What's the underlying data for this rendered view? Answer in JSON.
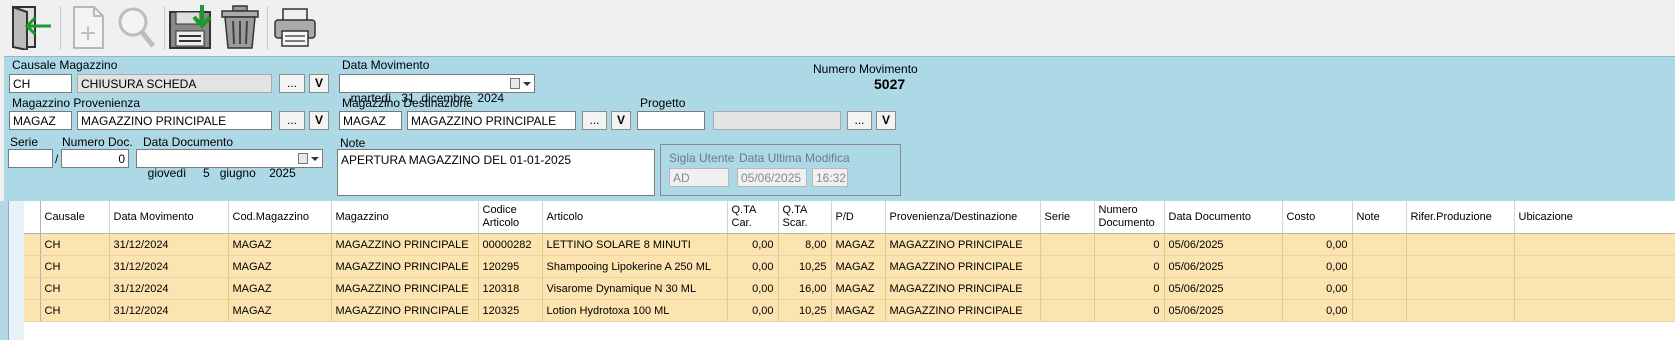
{
  "toolbar": {
    "buttons": [
      {
        "name": "exit-icon"
      },
      {
        "name": "new-document-icon"
      },
      {
        "name": "search-icon"
      },
      {
        "name": "save-icon"
      },
      {
        "name": "trash-icon"
      },
      {
        "name": "printer-icon"
      }
    ]
  },
  "form": {
    "causale_label": "Causale Magazzino",
    "causale_code": "CH",
    "causale_desc": "CHIUSURA SCHEDA",
    "dots": "...",
    "v": "V",
    "data_mov_label": "Data Movimento",
    "data_mov_value": "martedì   31  dicembre  2024",
    "num_mov_label": "Numero Movimento",
    "num_mov_value": "5027",
    "prov_label": "Magazzino Provenienza",
    "prov_code": "MAGAZ",
    "prov_desc": "MAGAZZINO PRINCIPALE",
    "dest_label": "Magazzino Destinazione",
    "dest_code": "MAGAZ",
    "dest_desc": "MAGAZZINO PRINCIPALE",
    "progetto_label": "Progetto",
    "progetto_code": "",
    "progetto_desc": "",
    "serie_label": "Serie",
    "serie_value": "",
    "slash": "/",
    "numdoc_label": "Numero Doc.",
    "numdoc_value": "0",
    "datadoc_label": "Data Documento",
    "datadoc_value": "giovedì     5   giugno    2025",
    "note_label": "Note",
    "note_value": "APERTURA MAGAZZINO DEL 01-01-2025",
    "sigla_label": "Sigla Utente",
    "sigla_value": "AD",
    "ultima_label": "Data Ultima Modifica",
    "ultima_date": "05/06/2025",
    "ultima_time": "16:32"
  },
  "grid": {
    "columns": [
      "Causale",
      "Data Movimento",
      "Cod.Magazzino",
      "Magazzino",
      "Codice Articolo",
      "Articolo",
      "Q.TA Car.",
      "Q.TA Scar.",
      "P/D",
      "Provenienza/Destinazione",
      "Serie",
      "Numero Documento",
      "Data Documento",
      "Costo",
      "Note",
      "Rifer.Produzione",
      "Ubicazione"
    ],
    "rows": [
      [
        "CH",
        "31/12/2024",
        "MAGAZ",
        "MAGAZZINO PRINCIPALE",
        "00000282",
        "LETTINO SOLARE 8 MINUTI",
        "0,00",
        "8,00",
        "MAGAZ",
        "MAGAZZINO PRINCIPALE",
        "",
        "0",
        "05/06/2025",
        "0,00",
        "",
        "",
        ""
      ],
      [
        "CH",
        "31/12/2024",
        "MAGAZ",
        "MAGAZZINO PRINCIPALE",
        "120295",
        "Shampooing Lipokerine A 250 ML",
        "0,00",
        "10,25",
        "MAGAZ",
        "MAGAZZINO PRINCIPALE",
        "",
        "0",
        "05/06/2025",
        "0,00",
        "",
        "",
        ""
      ],
      [
        "CH",
        "31/12/2024",
        "MAGAZ",
        "MAGAZZINO PRINCIPALE",
        "120318",
        "Visarome Dynamique N 30 ML",
        "0,00",
        "16,00",
        "MAGAZ",
        "MAGAZZINO PRINCIPALE",
        "",
        "0",
        "05/06/2025",
        "0,00",
        "",
        "",
        ""
      ],
      [
        "CH",
        "31/12/2024",
        "MAGAZ",
        "MAGAZZINO PRINCIPALE",
        "120325",
        "Lotion Hydrotoxa 100 ML",
        "0,00",
        "10,25",
        "MAGAZ",
        "MAGAZZINO PRINCIPALE",
        "",
        "0",
        "05/06/2025",
        "0,00",
        "",
        "",
        ""
      ]
    ]
  }
}
